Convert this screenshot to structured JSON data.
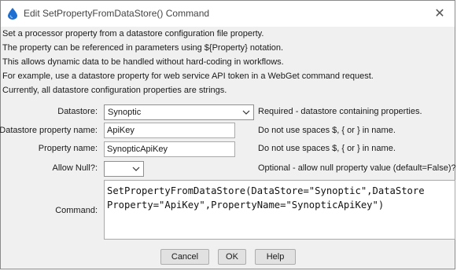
{
  "window": {
    "title": "Edit SetPropertyFromDataStore() Command",
    "close_glyph": "✕"
  },
  "description": [
    "Set a processor property from a datastore configuration file property.",
    "The property can be referenced in parameters using ${Property} notation.",
    "This allows dynamic data to be handled without hard-coding in workflows.",
    "For example, use a datastore property for web service API token in a WebGet command request.",
    "Currently, all datastore configuration properties are strings."
  ],
  "form": {
    "datastore": {
      "label": "Datastore:",
      "value": "Synoptic",
      "hint": "Required - datastore containing properties."
    },
    "datastore_property": {
      "label": "Datastore property name:",
      "value": "ApiKey",
      "hint": "Do not use spaces $, { or } in name."
    },
    "property_name": {
      "label": "Property name:",
      "value": "SynopticApiKey",
      "hint": "Do not use spaces $, { or } in name."
    },
    "allow_null": {
      "label": "Allow Null?:",
      "value": "",
      "hint": "Optional - allow null property value (default=False)?"
    },
    "command": {
      "label": "Command:",
      "lines": [
        "SetPropertyFromDataStore(DataStore=\"Synoptic\",DataStore",
        "Property=\"ApiKey\",PropertyName=\"SynopticApiKey\")"
      ]
    }
  },
  "buttons": {
    "cancel": "Cancel",
    "ok": "OK",
    "help": "Help"
  },
  "icons": {
    "title_icon": "water-drop-icon",
    "chevron": "chevron-down-icon"
  },
  "colors": {
    "accent": "#1f6fd1",
    "window_bg": "#f0f0f0"
  }
}
